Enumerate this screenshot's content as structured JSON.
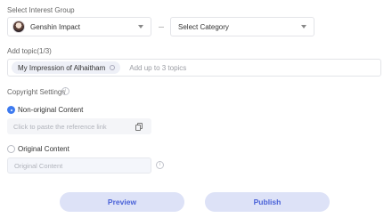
{
  "interest_group": {
    "label": "Select Interest Group",
    "game_select": {
      "value": "Genshin Impact"
    },
    "category_select": {
      "value": "Select Category"
    }
  },
  "topics": {
    "label": "Add topic(1/3)",
    "chips": [
      "My Impression of Alhaitham"
    ],
    "placeholder": "Add up to 3 topics"
  },
  "copyright": {
    "label": "Copyright Settings",
    "options": [
      {
        "label": "Non-original Content",
        "selected": true,
        "input_placeholder": "Click to paste the reference link"
      },
      {
        "label": "Original Content",
        "selected": false,
        "input_placeholder": "Original Content"
      }
    ]
  },
  "actions": {
    "preview": "Preview",
    "publish": "Publish"
  },
  "colors": {
    "accent": "#3e7bf0",
    "button_bg": "#dde2f7",
    "button_text": "#4a62d8"
  }
}
